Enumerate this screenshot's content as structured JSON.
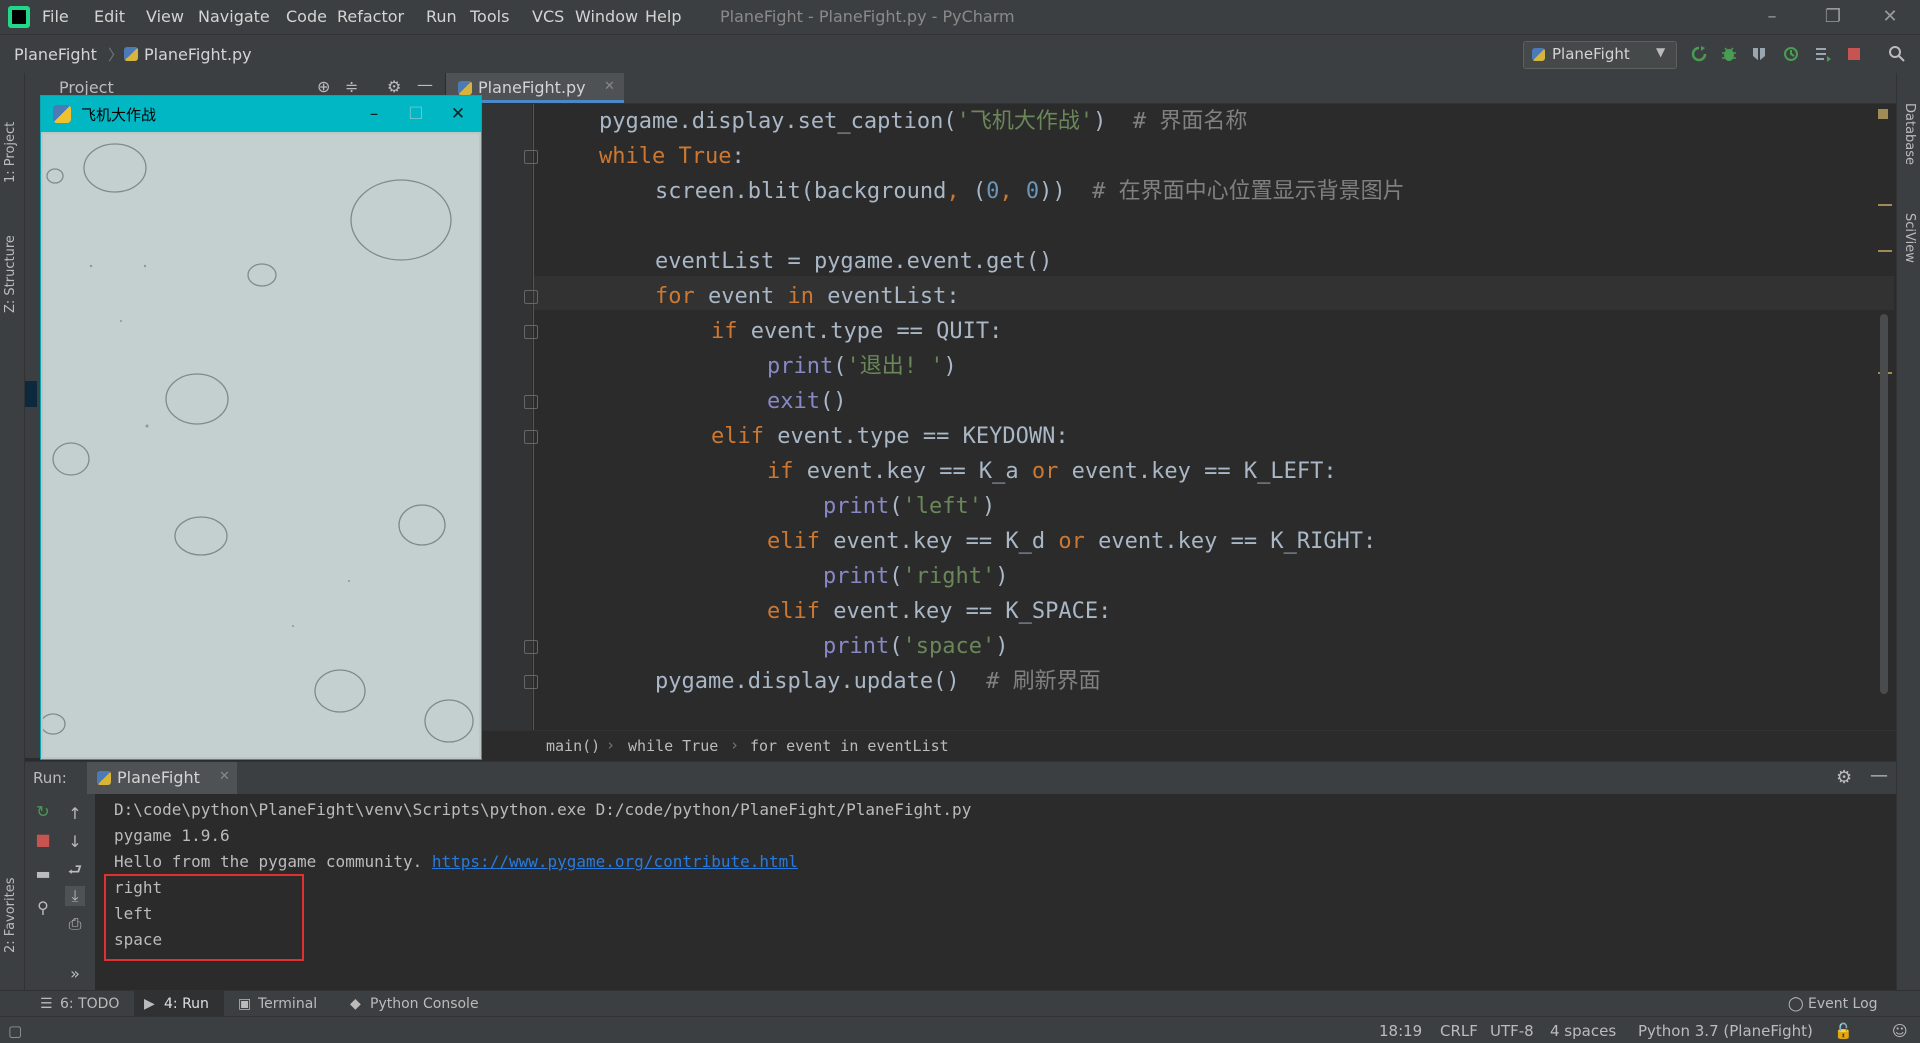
{
  "app": {
    "window_title": "PlaneFight - PlaneFight.py - PyCharm",
    "menu": [
      "File",
      "Edit",
      "View",
      "Navigate",
      "Code",
      "Refactor",
      "Run",
      "Tools",
      "VCS",
      "Window",
      "Help"
    ]
  },
  "navbar": {
    "project_crumb": "PlaneFight",
    "file_crumb": "PlaneFight.py",
    "run_config": "PlaneFight"
  },
  "left_strip": {
    "project_tab": "1: Project",
    "structure_tab": "Z: Structure",
    "favorites_tab": "2: Favorites"
  },
  "right_strip": {
    "database_tab": "Database",
    "sciview_tab": "SciView"
  },
  "project_panel": {
    "title": "Project"
  },
  "editor": {
    "tab_label": "PlaneFight.py",
    "breadcrumb": [
      "main()",
      "while True",
      "for event in eventList"
    ]
  },
  "code_lines": [
    "pygame.display.set_caption('飞机大作战')  # 界面名称",
    "while True:",
    "screen.blit(background, (0, 0))  # 在界面中心位置显示背景图片",
    "",
    "eventList = pygame.event.get()",
    "for event in eventList:",
    "if event.type == QUIT:",
    "print('退出! ')",
    "exit()",
    "elif event.type == KEYDOWN:",
    "if event.key == K_a or event.key == K_LEFT:",
    "print('left')",
    "elif event.key == K_d or event.key == K_RIGHT:",
    "print('right')",
    "elif event.key == K_SPACE:",
    "print('space')",
    "pygame.display.update()  # 刷新界面"
  ],
  "pygame_window": {
    "title": "飞机大作战"
  },
  "run_panel": {
    "label": "Run:",
    "tab_label": "PlaneFight",
    "console": {
      "command": "D:\\code\\python\\PlaneFight\\venv\\Scripts\\python.exe D:/code/python/PlaneFight/PlaneFight.py",
      "version": "pygame 1.9.6",
      "hello_prefix": "Hello from the pygame community. ",
      "hello_link": "https://www.pygame.org/contribute.html",
      "out1": "right",
      "out2": "left",
      "out3": "space"
    }
  },
  "bottom_tabs": {
    "todo": "6: TODO",
    "run": "4: Run",
    "terminal": "Terminal",
    "python_console": "Python Console",
    "event_log": "Event Log"
  },
  "status": {
    "position": "18:19",
    "line_sep": "CRLF",
    "encoding": "UTF-8",
    "indent": "4 spaces",
    "interpreter": "Python 3.7 (PlaneFight)"
  }
}
